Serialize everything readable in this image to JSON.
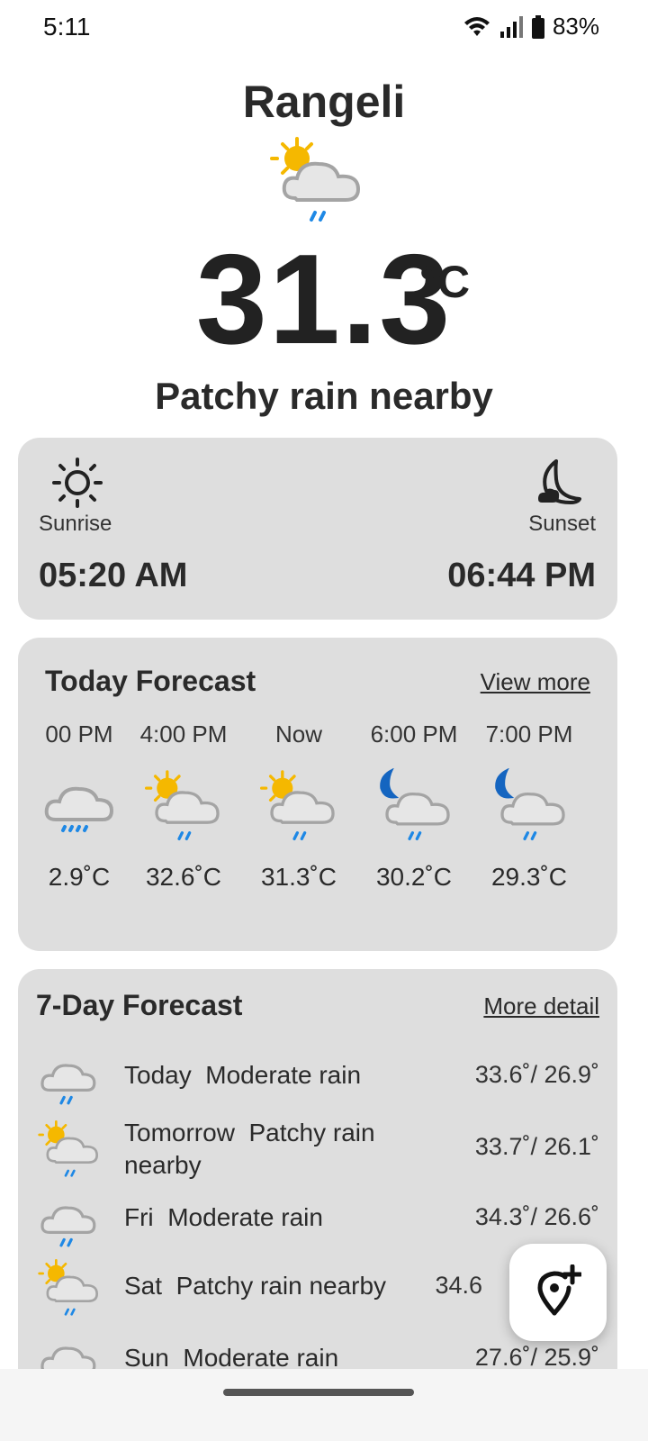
{
  "status": {
    "time": "5:11",
    "battery": "83%"
  },
  "current": {
    "city": "Rangeli",
    "temperature": "31.3",
    "unit": "°C",
    "condition": "Patchy rain nearby",
    "icon": "sun-cloud-rain-icon"
  },
  "sun": {
    "sunrise_label": "Sunrise",
    "sunrise_time": "05:20 AM",
    "sunset_label": "Sunset",
    "sunset_time": "06:44 PM"
  },
  "today": {
    "title": "Today Forecast",
    "link": "View more",
    "hours": [
      {
        "time": "00 PM",
        "temp": "2.9˚C",
        "icon": "cloud-rain-icon"
      },
      {
        "time": "4:00 PM",
        "temp": "32.6˚C",
        "icon": "sun-cloud-rain-icon"
      },
      {
        "time": "Now",
        "temp": "31.3˚C",
        "icon": "sun-cloud-rain-icon"
      },
      {
        "time": "6:00 PM",
        "temp": "30.2˚C",
        "icon": "moon-cloud-rain-icon"
      },
      {
        "time": "7:00 PM",
        "temp": "29.3˚C",
        "icon": "moon-cloud-rain-icon"
      }
    ]
  },
  "week": {
    "title": "7-Day Forecast",
    "link": "More detail",
    "days": [
      {
        "day": "Today",
        "condition": "Moderate rain",
        "temps": "33.6˚/ 26.9˚",
        "icon": "cloud-rain-icon"
      },
      {
        "day": "Tomorrow",
        "condition": "Patchy rain nearby",
        "temps": "33.7˚/ 26.1˚",
        "icon": "sun-cloud-rain-icon"
      },
      {
        "day": "Fri",
        "condition": "Moderate rain",
        "temps": "34.3˚/ 26.6˚",
        "icon": "cloud-rain-icon"
      },
      {
        "day": "Sat",
        "condition": "Patchy rain nearby",
        "temps": "34.6",
        "icon": "sun-cloud-rain-icon"
      },
      {
        "day": "Sun",
        "condition": "Moderate rain",
        "temps": "27.6˚/ 25.9˚",
        "icon": "cloud-rain-icon"
      }
    ]
  },
  "fab": {
    "icon": "add-location-icon"
  },
  "colors": {
    "card": "#dedede",
    "rain": "#1e88e5",
    "sun": "#f5b800",
    "moon": "#1565c0"
  }
}
